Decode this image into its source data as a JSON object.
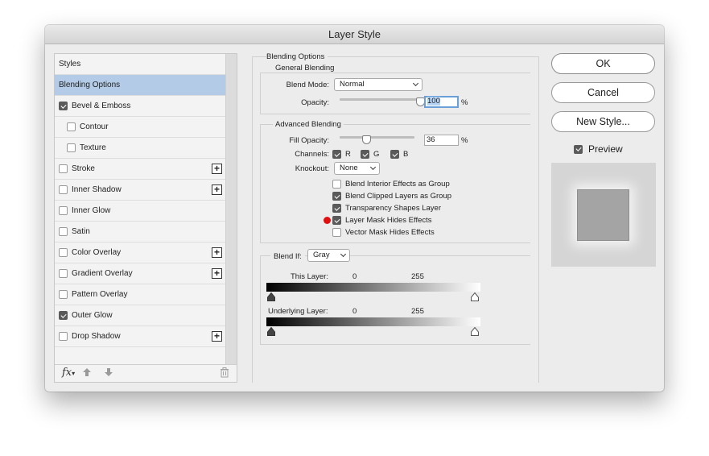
{
  "window": {
    "title": "Layer Style"
  },
  "styles_panel": {
    "header": "Styles",
    "items": [
      {
        "label": "Blending Options",
        "selected": true,
        "has_checkbox": false,
        "checked": false,
        "plus": false,
        "indent": false
      },
      {
        "label": "Bevel & Emboss",
        "selected": false,
        "has_checkbox": true,
        "checked": true,
        "plus": false,
        "indent": false
      },
      {
        "label": "Contour",
        "selected": false,
        "has_checkbox": true,
        "checked": false,
        "plus": false,
        "indent": true
      },
      {
        "label": "Texture",
        "selected": false,
        "has_checkbox": true,
        "checked": false,
        "plus": false,
        "indent": true
      },
      {
        "label": "Stroke",
        "selected": false,
        "has_checkbox": true,
        "checked": false,
        "plus": true,
        "indent": false
      },
      {
        "label": "Inner Shadow",
        "selected": false,
        "has_checkbox": true,
        "checked": false,
        "plus": true,
        "indent": false
      },
      {
        "label": "Inner Glow",
        "selected": false,
        "has_checkbox": true,
        "checked": false,
        "plus": false,
        "indent": false
      },
      {
        "label": "Satin",
        "selected": false,
        "has_checkbox": true,
        "checked": false,
        "plus": false,
        "indent": false
      },
      {
        "label": "Color Overlay",
        "selected": false,
        "has_checkbox": true,
        "checked": false,
        "plus": true,
        "indent": false
      },
      {
        "label": "Gradient Overlay",
        "selected": false,
        "has_checkbox": true,
        "checked": false,
        "plus": true,
        "indent": false
      },
      {
        "label": "Pattern Overlay",
        "selected": false,
        "has_checkbox": true,
        "checked": false,
        "plus": false,
        "indent": false
      },
      {
        "label": "Outer Glow",
        "selected": false,
        "has_checkbox": true,
        "checked": true,
        "plus": false,
        "indent": false
      },
      {
        "label": "Drop Shadow",
        "selected": false,
        "has_checkbox": true,
        "checked": false,
        "plus": true,
        "indent": false
      }
    ],
    "footer": {
      "fx_label": "fx",
      "icons": [
        "fx-icon",
        "move-up-icon",
        "move-down-icon",
        "trash-icon"
      ]
    }
  },
  "blending_options": {
    "section_title": "Blending Options",
    "general": {
      "title": "General Blending",
      "blend_mode_label": "Blend Mode:",
      "blend_mode_value": "Normal",
      "opacity_label": "Opacity:",
      "opacity_value": "100",
      "opacity_unit": "%",
      "opacity_level": 1.0
    },
    "advanced": {
      "title": "Advanced Blending",
      "fill_opacity_label": "Fill Opacity:",
      "fill_opacity_value": "36",
      "fill_opacity_unit": "%",
      "fill_opacity_level": 0.36,
      "channels_label": "Channels:",
      "channels": [
        {
          "label": "R",
          "checked": true
        },
        {
          "label": "G",
          "checked": true
        },
        {
          "label": "B",
          "checked": true
        }
      ],
      "knockout_label": "Knockout:",
      "knockout_value": "None",
      "options": [
        {
          "label": "Blend Interior Effects as Group",
          "checked": false
        },
        {
          "label": "Blend Clipped Layers as Group",
          "checked": true
        },
        {
          "label": "Transparency Shapes Layer",
          "checked": true
        },
        {
          "label": "Layer Mask Hides Effects",
          "checked": true
        },
        {
          "label": "Vector Mask Hides Effects",
          "checked": false
        }
      ]
    },
    "blend_if": {
      "label": "Blend If:",
      "value": "Gray",
      "this_layer": {
        "label": "This Layer:",
        "min": "0",
        "max": "255"
      },
      "underlying_layer": {
        "label": "Underlying Layer:",
        "min": "0",
        "max": "255"
      }
    }
  },
  "buttons": {
    "ok": "OK",
    "cancel": "Cancel",
    "new_style": "New Style..."
  },
  "preview": {
    "label": "Preview",
    "checked": true
  },
  "colors": {
    "selection": "#b3cbe6",
    "focus": "#6b9fd9",
    "marker": "#e11010",
    "preview_swatch": "#a4a4a4"
  }
}
